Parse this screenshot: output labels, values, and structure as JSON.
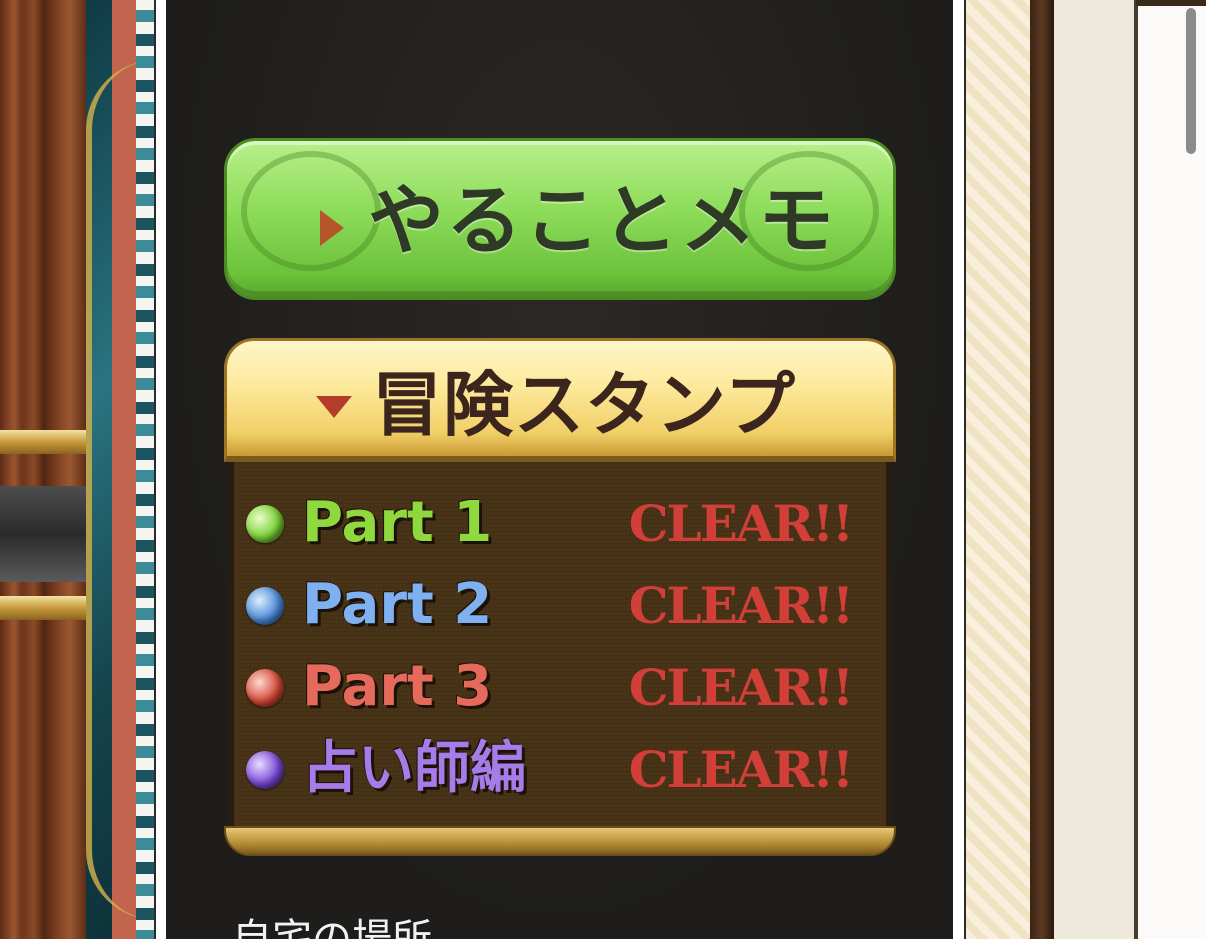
{
  "memo_button": {
    "label": "やることメモ",
    "arrow_icon": "triangle-right-icon"
  },
  "stamp_panel": {
    "title": "冒険スタンプ",
    "toggle_icon": "triangle-down-icon",
    "rows": [
      {
        "label": "Part 1",
        "status": "CLEAR!!",
        "label_color": "#8fd83e",
        "orb_color": "#7ccf3a"
      },
      {
        "label": "Part 2",
        "status": "CLEAR!!",
        "label_color": "#7fb0ef",
        "orb_color": "#4f8bd6"
      },
      {
        "label": "Part 3",
        "status": "CLEAR!!",
        "label_color": "#e56a5c",
        "orb_color": "#d24a3a"
      },
      {
        "label": "占い師編",
        "status": "CLEAR!!",
        "label_color": "#a77ce8",
        "orb_color": "#7a4ad6"
      }
    ],
    "status_color": "#d9403a"
  },
  "home_section": {
    "text": "自宅の場所"
  }
}
